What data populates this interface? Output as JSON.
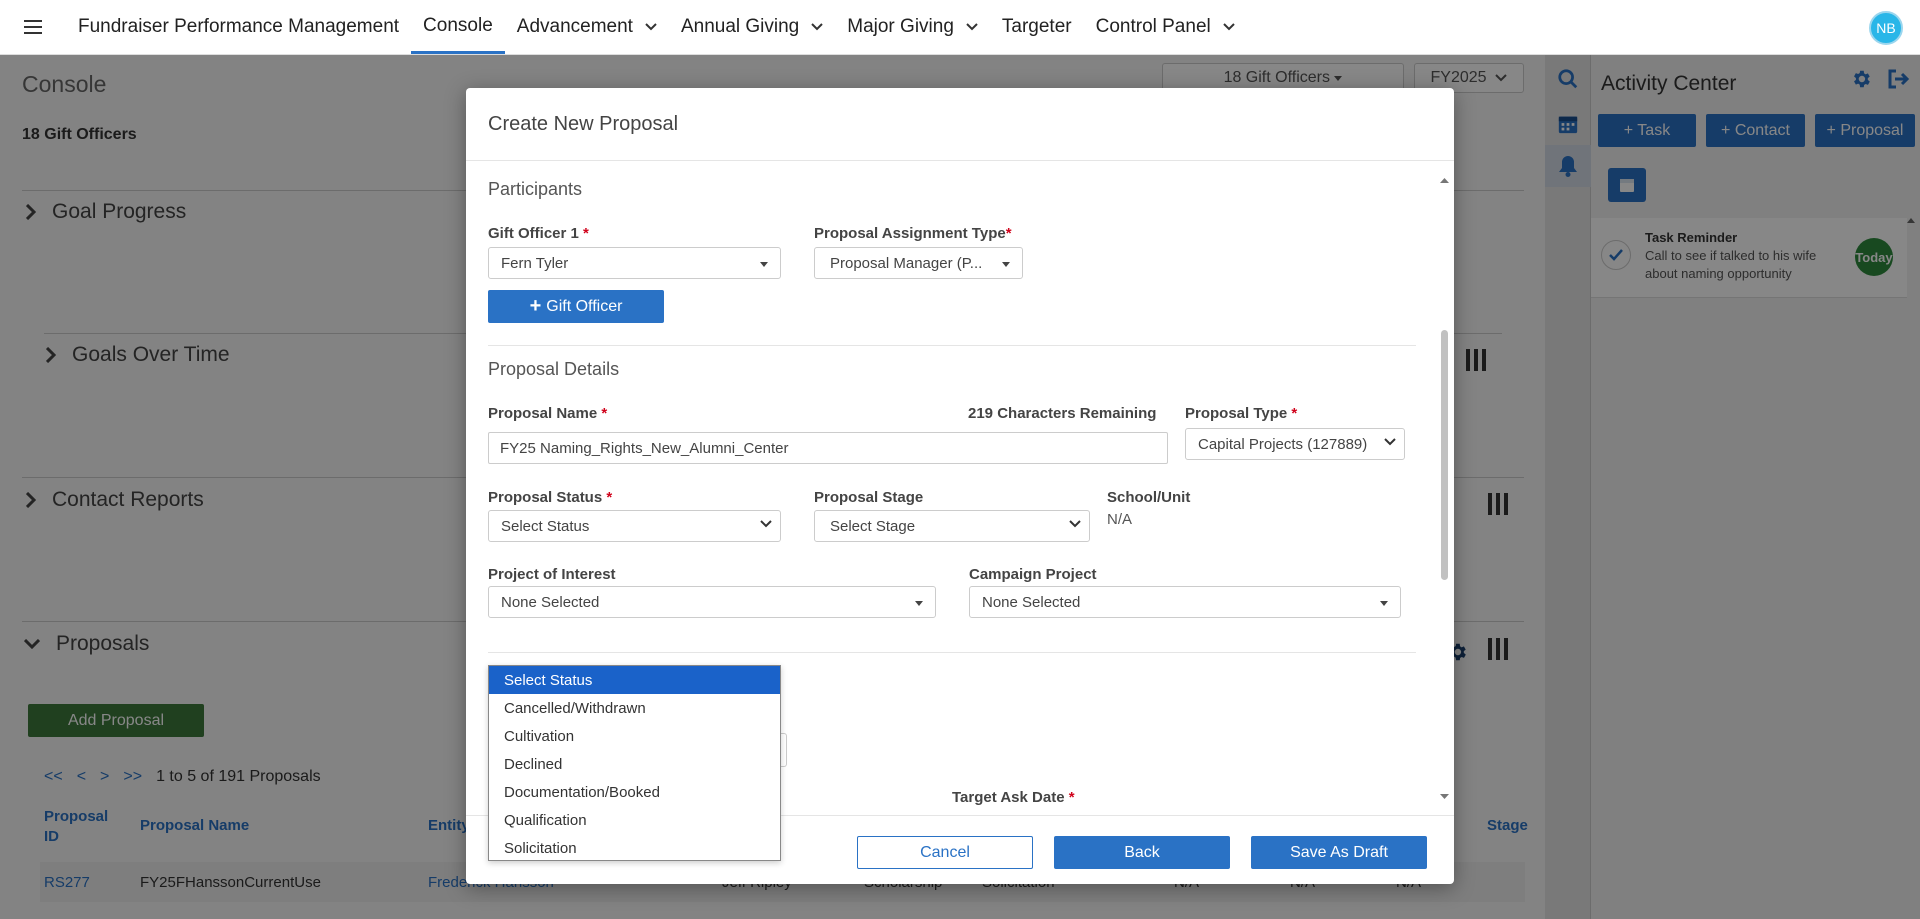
{
  "nav": {
    "items": [
      {
        "label": "Fundraiser Performance Management",
        "dropdown": false,
        "active": false
      },
      {
        "label": "Console",
        "dropdown": false,
        "active": true
      },
      {
        "label": "Advancement",
        "dropdown": true,
        "active": false
      },
      {
        "label": "Annual Giving",
        "dropdown": true,
        "active": false
      },
      {
        "label": "Major Giving",
        "dropdown": true,
        "active": false
      },
      {
        "label": "Targeter",
        "dropdown": false,
        "active": false
      },
      {
        "label": "Control Panel",
        "dropdown": true,
        "active": false
      }
    ],
    "avatar": "NB"
  },
  "console": {
    "title": "Console",
    "officers_label": "18 Gift Officers",
    "officers_filter": "18 Gift Officers",
    "fy_filter": "FY2025",
    "sections": {
      "goal_progress": "Goal Progress",
      "goals_over_time": "Goals Over Time",
      "contact_reports": "Contact Reports",
      "proposals": "Proposals"
    },
    "add_proposal": "Add Proposal",
    "pager": {
      "first": "<<",
      "prev": "<",
      "next": ">",
      "last": ">>",
      "summary": "1 to 5 of 191 Proposals"
    },
    "table": {
      "headers": {
        "id_line1": "Proposal",
        "id_line2": "ID",
        "name": "Proposal Name",
        "entity": "Entity",
        "stage": "Stage"
      },
      "row1": {
        "id": "RS277",
        "name": "FY25FHanssonCurrentUse",
        "entity": "Frederick Hansson",
        "officer": "Jeff Ripley",
        "type": "Scholarship",
        "status": "Solicitation",
        "na1": "N/A",
        "na2": "N/A",
        "na3": "N/A"
      }
    }
  },
  "activity": {
    "title": "Activity Center",
    "buttons": {
      "task": "+ Task",
      "contact": "+ Contact",
      "proposal": "+ Proposal"
    },
    "task": {
      "title": "Task Reminder",
      "line1": "Call to see if talked to his wife",
      "line2": "about naming opportunity",
      "badge": "Today"
    }
  },
  "modal": {
    "title": "Create New Proposal",
    "participants": {
      "heading": "Participants",
      "officer_label": "Gift Officer 1",
      "officer_value": "Fern Tyler",
      "assignment_label": "Proposal Assignment Type",
      "assignment_value": "Proposal Manager (P...",
      "add_officer": "Gift Officer"
    },
    "details": {
      "heading": "Proposal Details",
      "name_label": "Proposal Name",
      "chars_remaining": "219 Characters Remaining",
      "name_value": "FY25 Naming_Rights_New_Alumni_Center",
      "type_label": "Proposal Type",
      "type_value": "Capital Projects (127889)",
      "status_label": "Proposal Status",
      "status_value": "Select Status",
      "stage_label": "Proposal Stage",
      "stage_value": "Select Stage",
      "school_label": "School/Unit",
      "school_value": "N/A",
      "project_label": "Project of Interest",
      "project_value": "None Selected",
      "campaign_label": "Campaign Project",
      "campaign_value": "None Selected",
      "target_date_label": "Target Ask Date"
    },
    "status_options": [
      "Select Status",
      "Cancelled/Withdrawn",
      "Cultivation",
      "Declined",
      "Documentation/Booked",
      "Qualification",
      "Solicitation"
    ],
    "footer": {
      "cancel": "Cancel",
      "back": "Back",
      "save": "Save As Draft"
    }
  },
  "colors": {
    "primary": "#2a72c5",
    "green": "#3d7a3b",
    "required": "#d0021b",
    "selected_option": "#1a62c9"
  }
}
